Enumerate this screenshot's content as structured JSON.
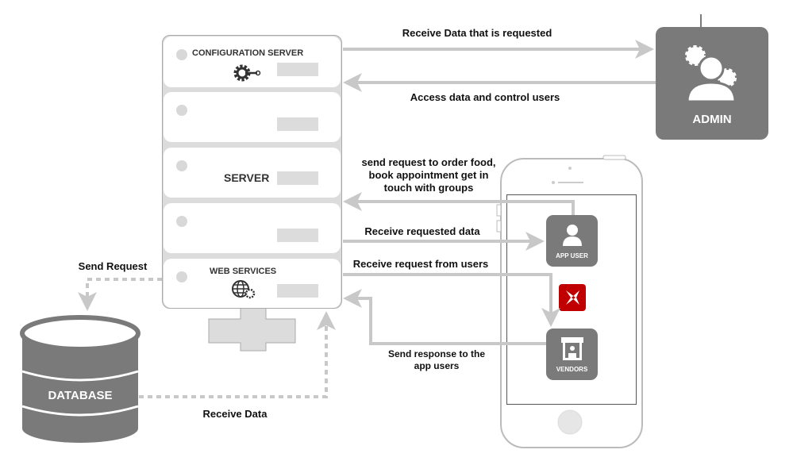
{
  "server": {
    "config_label": "CONFIGURATION SERVER",
    "server_label": "SERVER",
    "web_services_label": "WEB SERVICES"
  },
  "admin": {
    "label": "ADMIN"
  },
  "database": {
    "label": "DATABASE"
  },
  "phone": {
    "app_user_label": "APP USER",
    "vendors_label": "VENDORS"
  },
  "arrows": {
    "receive_requested_top": "Receive Data that is requested",
    "access_control": "Access data and control users",
    "send_request_order": [
      "send request to order food,",
      "book appointment get in",
      "touch with groups"
    ],
    "receive_requested_data": "Receive requested data",
    "receive_request_users": "Receive request from users",
    "send_response": [
      "Send response to the",
      "app users"
    ],
    "send_request_db": "Send Request",
    "receive_data_db": "Receive Data"
  },
  "colors": {
    "arrow": "#c8c8c8",
    "tile": "#7a7a7a",
    "brand_red": "#c00000"
  }
}
